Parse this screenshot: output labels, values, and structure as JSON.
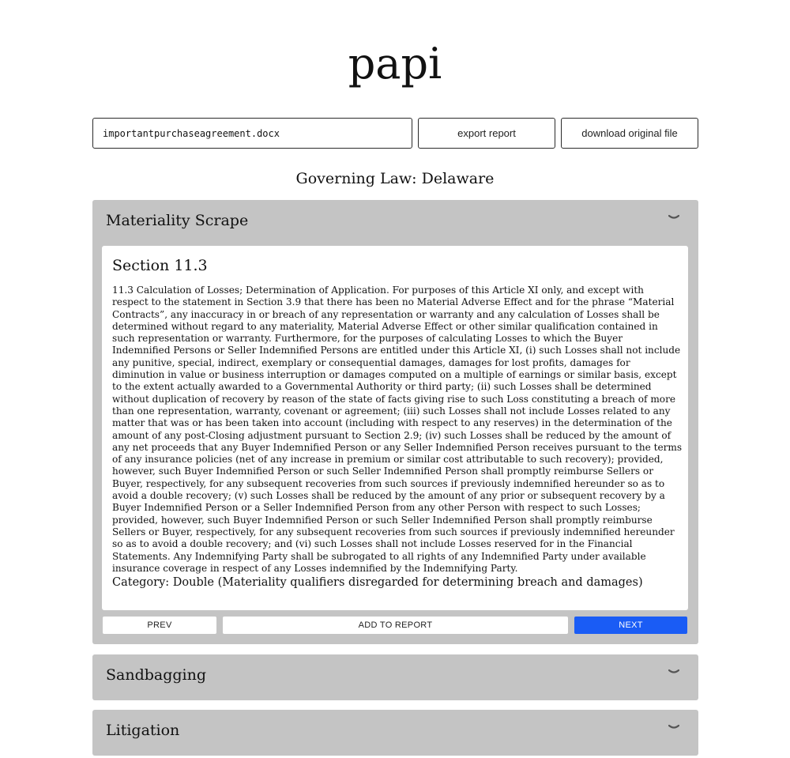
{
  "app": {
    "title": "papi"
  },
  "toolbar": {
    "file_name": "importantpurchaseagreement.docx",
    "export_label": "export report",
    "download_label": "download original file"
  },
  "governing_law": "Governing Law: Delaware",
  "sections": [
    {
      "title": "Materiality Scrape",
      "expanded": true,
      "clause_heading": "Section 11.3",
      "clause_text": "11.3 Calculation of Losses; Determination of Application. For purposes of this Article XI only, and except with respect to the statement in Section 3.9 that there has been no Material Adverse Effect and for the phrase “Material Contracts”, any inaccuracy in or breach of any representation or warranty and any calculation of Losses shall be determined without regard to any materiality, Material Adverse Effect or other similar qualification contained in such representation or warranty. Furthermore, for the purposes of calculating Losses to which the Buyer Indemnified Persons or Seller Indemnified Persons are entitled under this Article XI, (i) such Losses shall not include any punitive, special, indirect, exemplary or consequential damages, damages for lost profits, damages for diminution in value or business interruption or damages computed on a multiple of earnings or similar basis, except to the extent actually awarded to a Governmental Authority or third party; (ii) such Losses shall be determined without duplication of recovery by reason of the state of facts giving rise to such Loss constituting a breach of more than one representation, warranty, covenant or agreement; (iii) such Losses shall not include Losses related to any matter that was or has been taken into account (including with respect to any reserves) in the determination of the amount of any post-Closing adjustment pursuant to Section 2.9; (iv) such Losses shall be reduced by the amount of any net proceeds that any Buyer Indemnified Person or any Seller Indemnified Person receives pursuant to the terms of any insurance policies (net of any increase in premium or similar cost attributable to such recovery); provided, however, such Buyer Indemnified Person or such Seller Indemnified Person shall promptly reimburse Sellers or Buyer, respectively, for any subsequent recoveries from such sources if previously indemnified hereunder so as to avoid a double recovery; (v) such Losses shall be reduced by the amount of any prior or subsequent recovery by a Buyer Indemnified Person or a Seller Indemnified Person from any other Person with respect to such Losses; provided, however, such Buyer Indemnified Person or such Seller Indemnified Person shall promptly reimburse Sellers or Buyer, respectively, for any subsequent recoveries from such sources if previously indemnified hereunder so as to avoid a double recovery; and (vi) such Losses shall not include Losses reserved for in the Financial Statements. Any Indemnifying Party shall be subrogated to all rights of any Indemnified Party under available insurance coverage in respect of any Losses indemnified by the Indemnifying Party.",
      "category": "Category: Double (Materiality qualifiers disregarded for determining breach and damages)",
      "prev_label": "PREV",
      "add_label": "ADD TO REPORT",
      "next_label": "NEXT"
    },
    {
      "title": "Sandbagging",
      "expanded": false
    },
    {
      "title": "Litigation",
      "expanded": false
    }
  ],
  "colors": {
    "panel_bg": "#c4c4c4",
    "primary_button": "#1a5cf5"
  },
  "icons": {
    "collapse": "chevron-down-icon"
  }
}
